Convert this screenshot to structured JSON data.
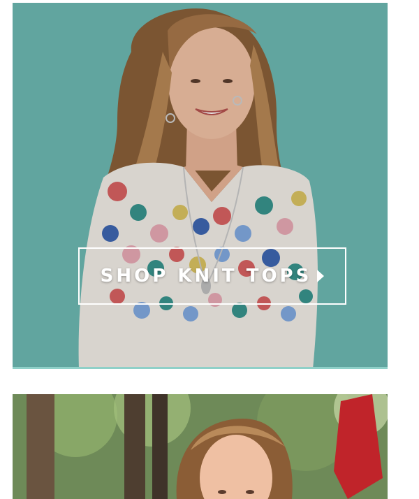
{
  "banners": [
    {
      "cta_label": "SHOP KNIT TOPS",
      "cta_icon": "caret-right-icon",
      "background_color": "#6db9b3"
    },
    {
      "background_color": "#5f7a4a"
    }
  ]
}
